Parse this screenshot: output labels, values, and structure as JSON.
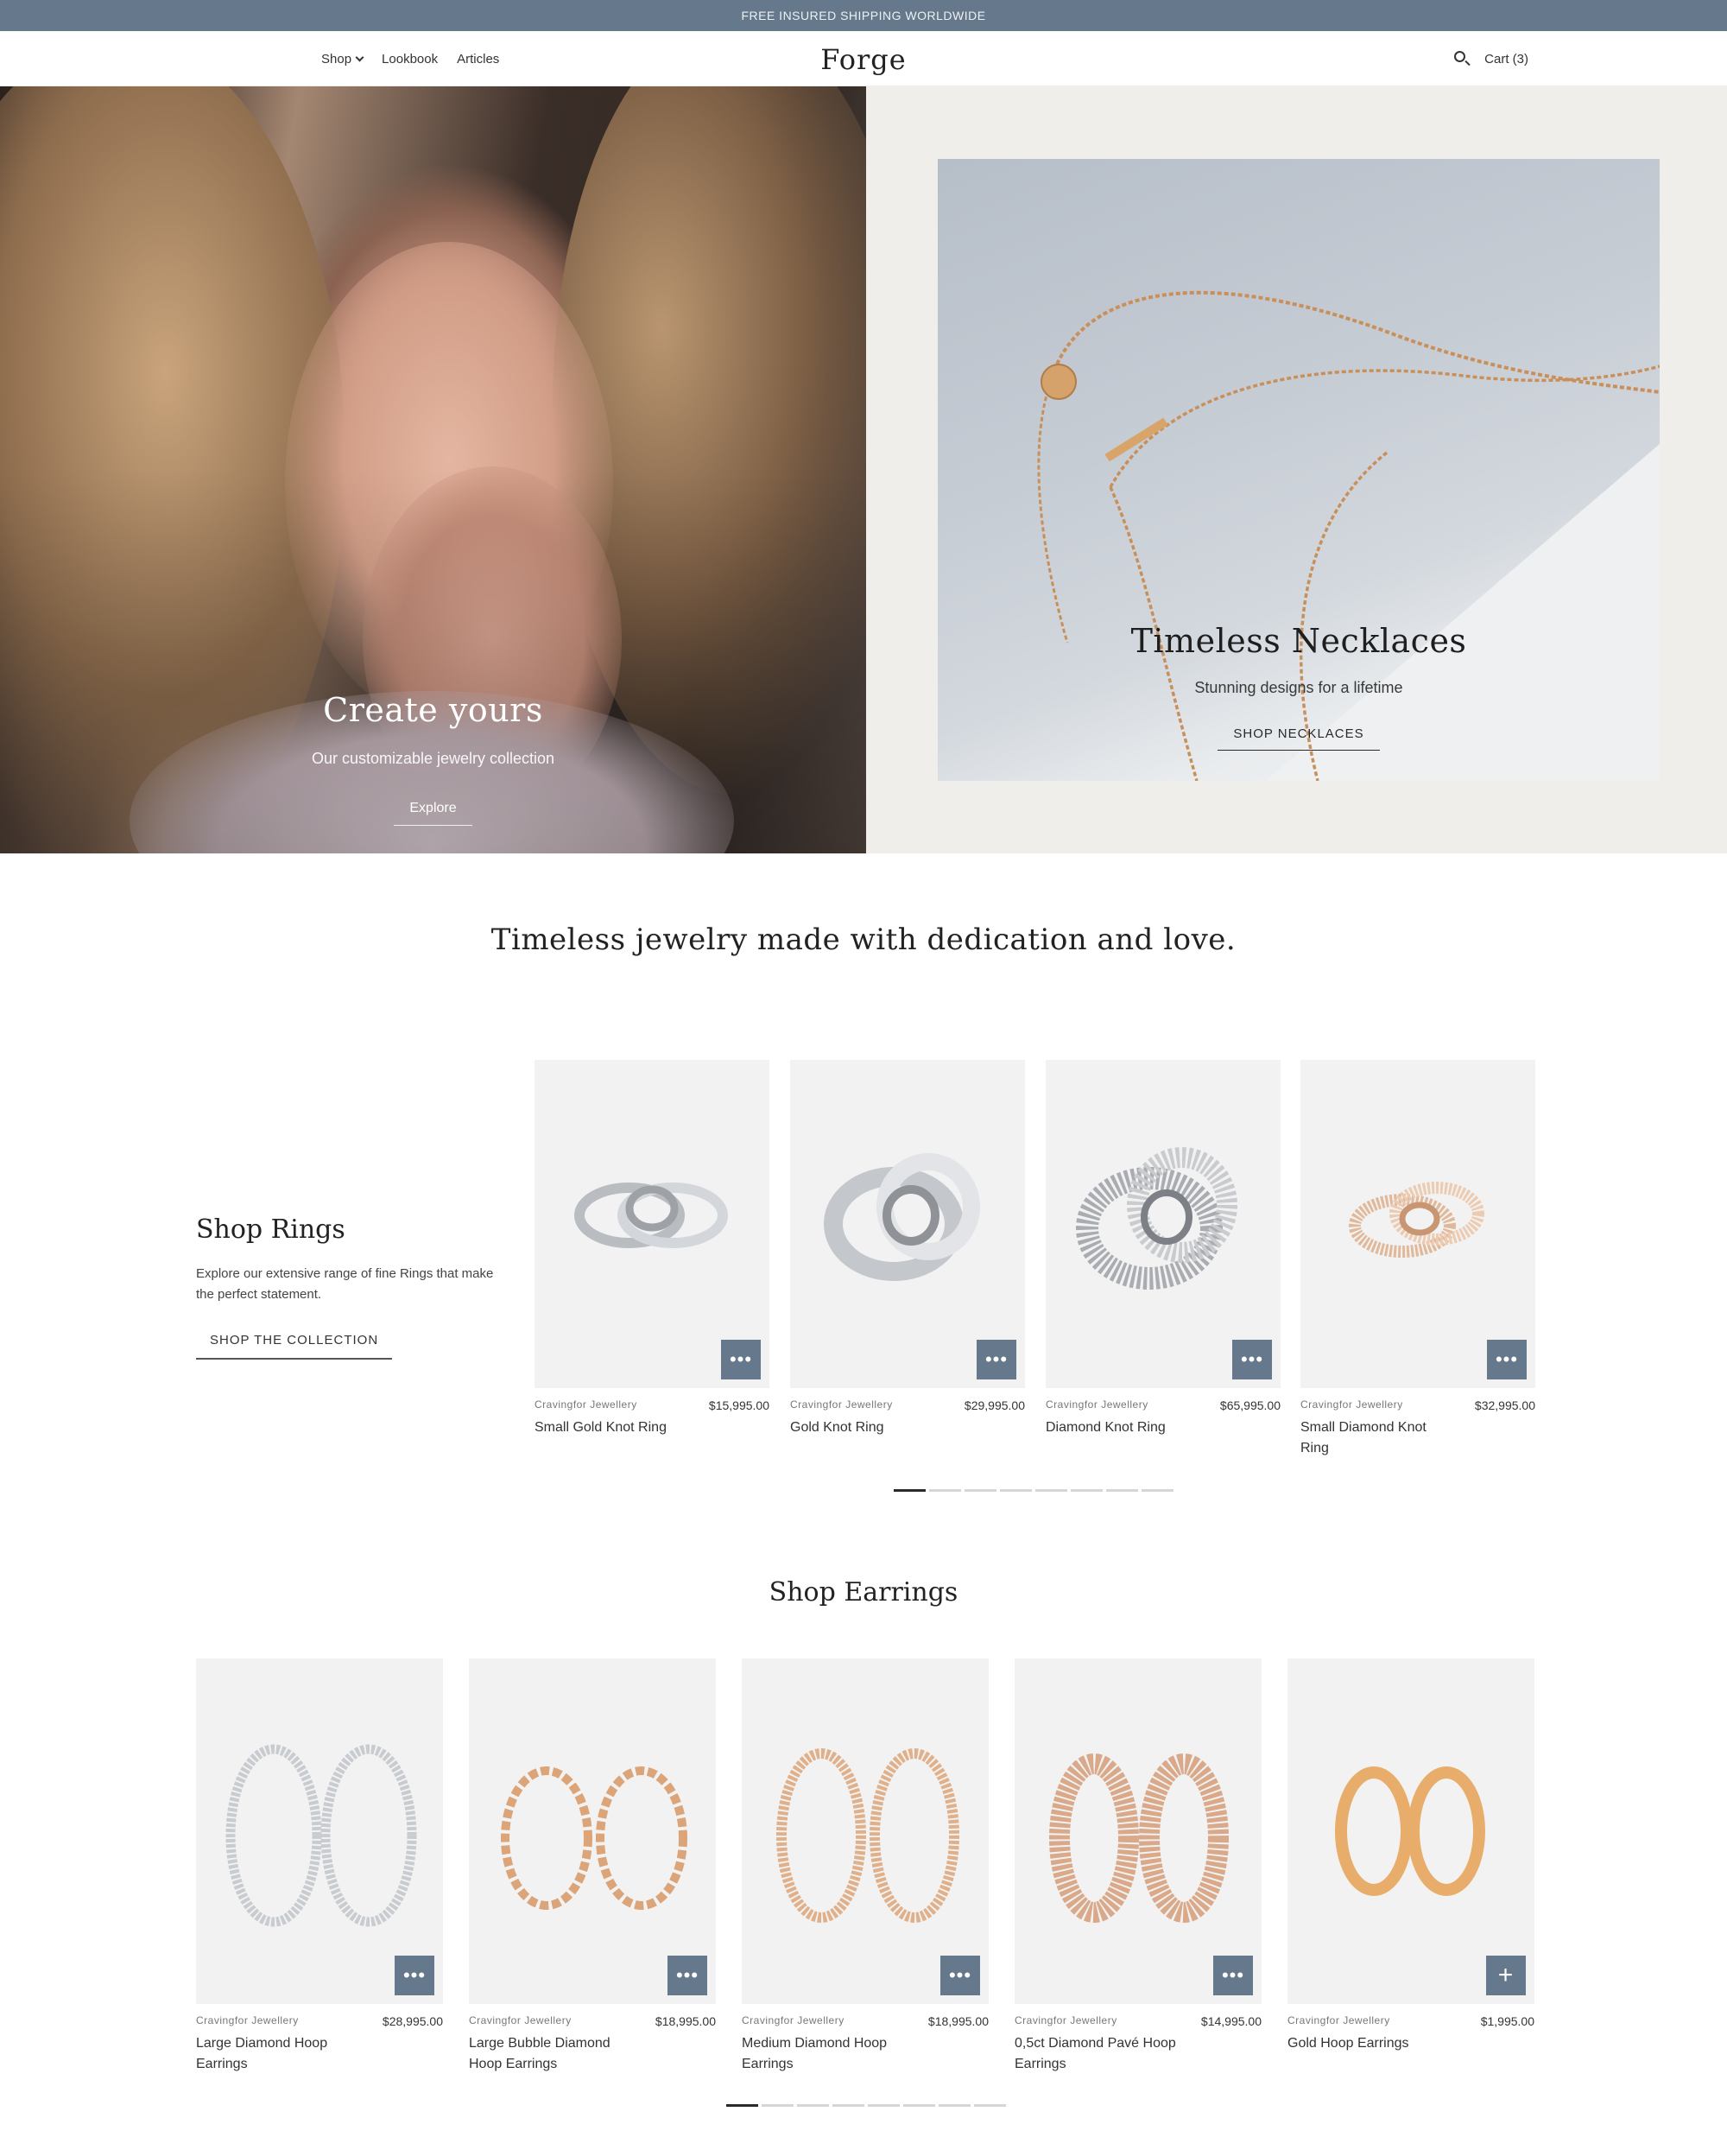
{
  "announcement": "FREE INSURED SHIPPING WORLDWIDE",
  "header": {
    "logo": "Forge",
    "nav": [
      "Shop",
      "Lookbook",
      "Articles"
    ],
    "cart_label": "Cart (3)"
  },
  "hero": {
    "left": {
      "title": "Create yours",
      "subtitle": "Our customizable jewelry collection",
      "link": "Explore"
    },
    "right": {
      "title": "Timeless Necklaces",
      "subtitle": "Stunning designs for a lifetime",
      "link": "SHOP NECKLACES"
    }
  },
  "tagline": "Timeless jewelry made with dedication and love.",
  "rings": {
    "title": "Shop Rings",
    "description": "Explore our extensive range of fine Rings that make the perfect statement.",
    "button": "SHOP THE COLLECTION",
    "products": [
      {
        "vendor": "Cravingfor Jewellery",
        "price": "$15,995.00",
        "name": "Small Gold Knot Ring",
        "action_icon": "more-icon"
      },
      {
        "vendor": "Cravingfor Jewellery",
        "price": "$29,995.00",
        "name": "Gold Knot Ring",
        "action_icon": "more-icon"
      },
      {
        "vendor": "Cravingfor Jewellery",
        "price": "$65,995.00",
        "name": "Diamond Knot Ring",
        "action_icon": "more-icon"
      },
      {
        "vendor": "Cravingfor Jewellery",
        "price": "$32,995.00",
        "name": "Small Diamond Knot Ring",
        "action_icon": "more-icon"
      }
    ]
  },
  "earrings": {
    "title": "Shop Earrings",
    "products": [
      {
        "vendor": "Cravingfor Jewellery",
        "price": "$28,995.00",
        "name": "Large Diamond Hoop Earrings",
        "action_icon": "more-icon"
      },
      {
        "vendor": "Cravingfor Jewellery",
        "price": "$18,995.00",
        "name": "Large Bubble Diamond Hoop Earrings",
        "action_icon": "more-icon"
      },
      {
        "vendor": "Cravingfor Jewellery",
        "price": "$18,995.00",
        "name": "Medium Diamond Hoop Earrings",
        "action_icon": "more-icon"
      },
      {
        "vendor": "Cravingfor Jewellery",
        "price": "$14,995.00",
        "name": "0,5ct Diamond Pavé Hoop Earrings",
        "action_icon": "more-icon"
      },
      {
        "vendor": "Cravingfor Jewellery",
        "price": "$1,995.00",
        "name": "Gold Hoop Earrings",
        "action_icon": "plus-icon"
      }
    ]
  },
  "colors": {
    "accent": "#66788b",
    "card_bg": "#f2f2f2",
    "hero_right_bg": "#efeeeb"
  },
  "pagination": {
    "rings_pages": 8,
    "rings_active": 1,
    "earrings_pages": 8,
    "earrings_active": 1
  }
}
